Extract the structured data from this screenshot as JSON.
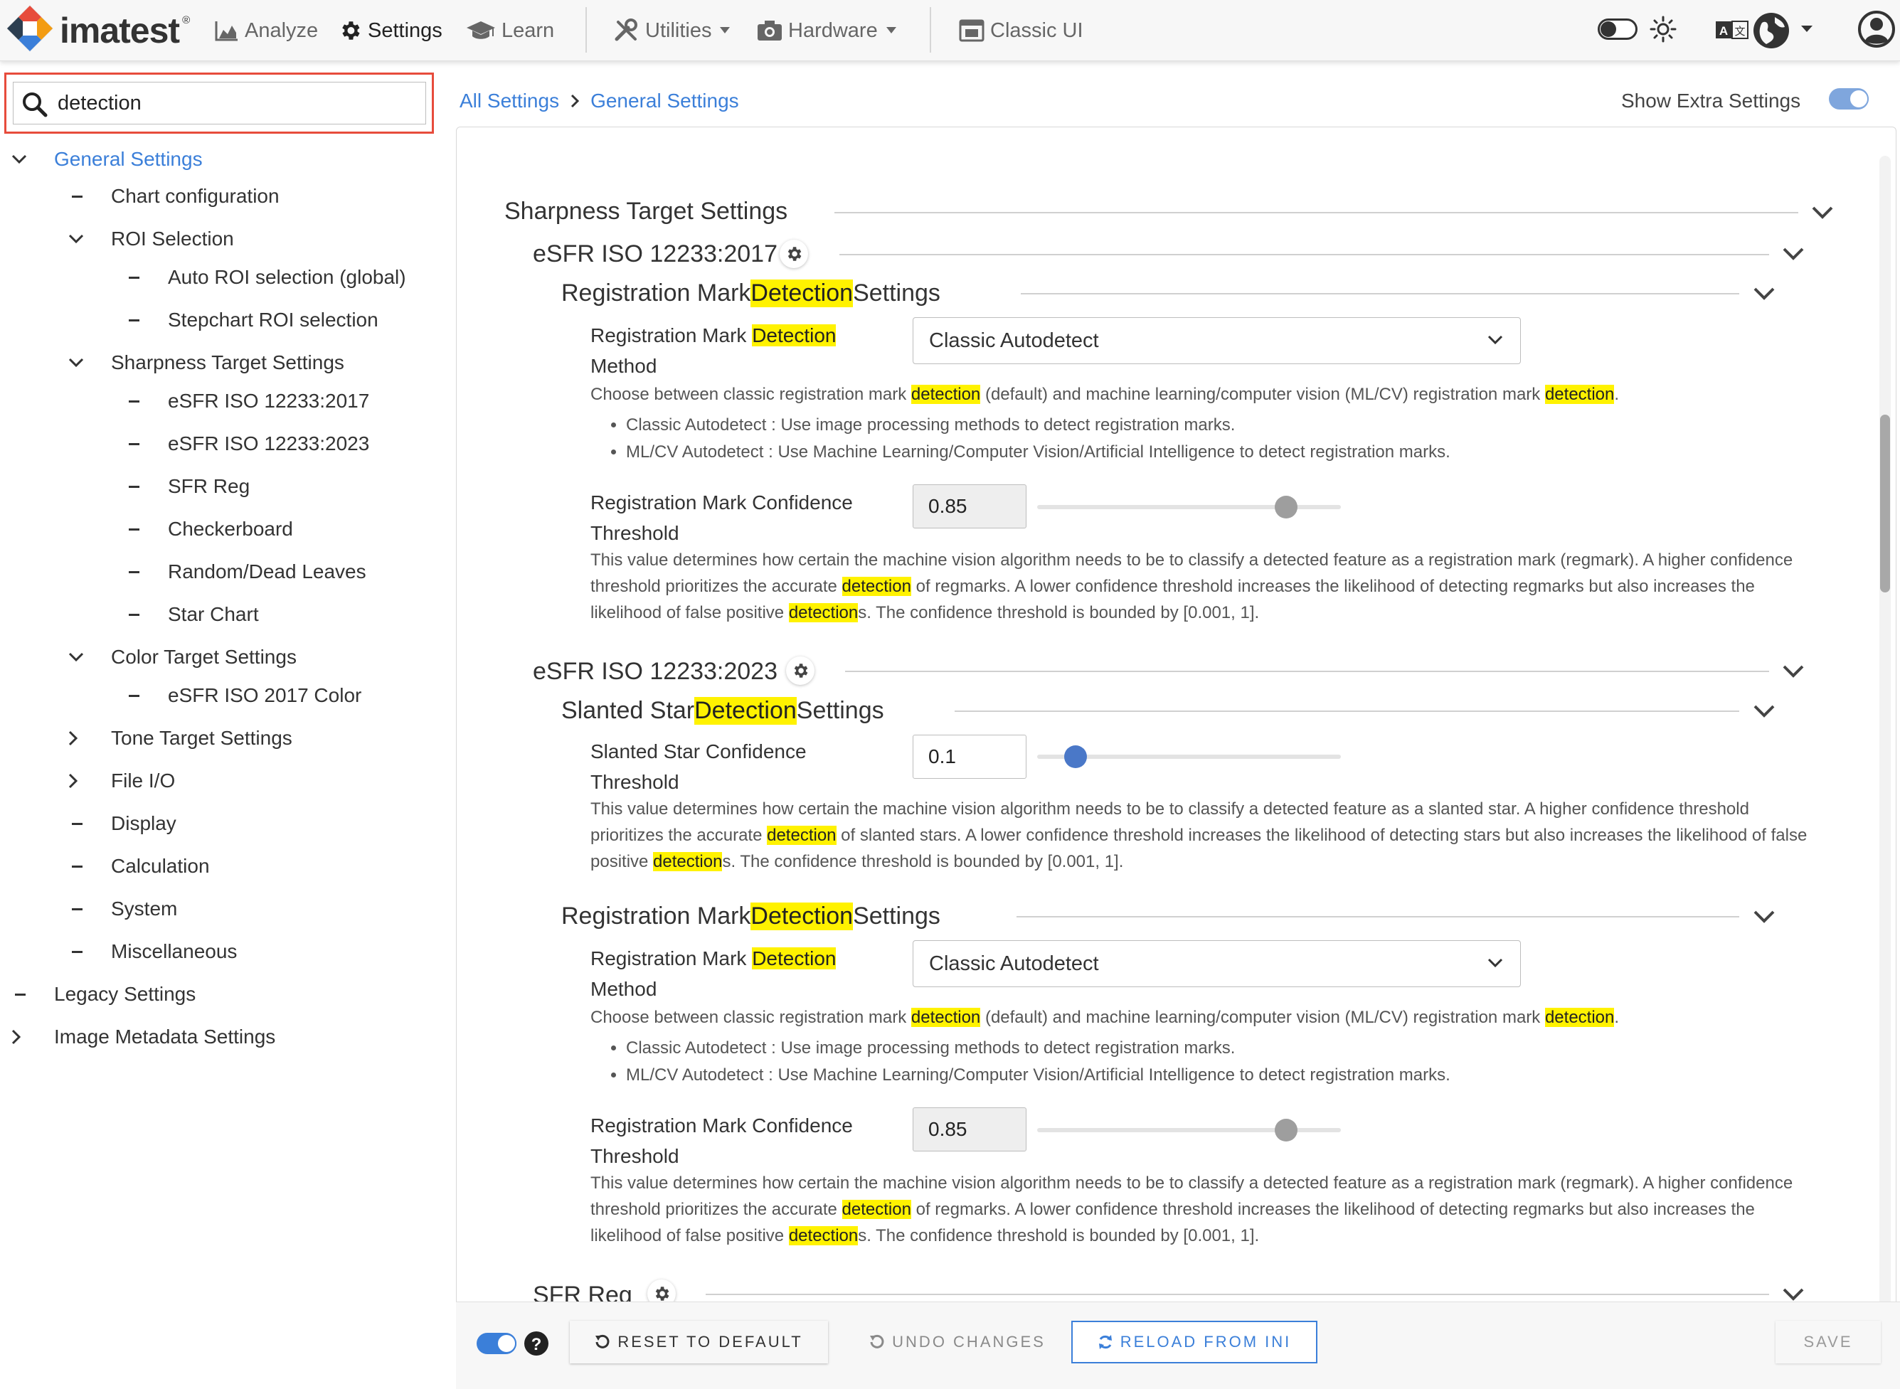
{
  "topbar": {
    "brand": "imatest",
    "brand_mark": "®",
    "nav": [
      {
        "label": "Analyze",
        "icon": "chart-area-icon"
      },
      {
        "label": "Settings",
        "icon": "gear-icon"
      },
      {
        "label": "Learn",
        "icon": "graduation-cap-icon"
      },
      {
        "label": "Utilities",
        "icon": "tools-icon"
      },
      {
        "label": "Hardware",
        "icon": "camera-icon"
      },
      {
        "label": "Classic UI",
        "icon": "window-icon"
      }
    ]
  },
  "search": {
    "value": "detection"
  },
  "tree": [
    {
      "label": "General Settings"
    },
    {
      "label": "Chart configuration"
    },
    {
      "label": "ROI Selection"
    },
    {
      "label": "Auto ROI selection (global)"
    },
    {
      "label": "Stepchart ROI selection"
    },
    {
      "label": "Sharpness Target Settings"
    },
    {
      "label": "eSFR ISO 12233:2017"
    },
    {
      "label": "eSFR ISO 12233:2023"
    },
    {
      "label": "SFR Reg"
    },
    {
      "label": "Checkerboard"
    },
    {
      "label": "Random/Dead Leaves"
    },
    {
      "label": "Star Chart"
    },
    {
      "label": "Color Target Settings"
    },
    {
      "label": "eSFR ISO 2017 Color"
    },
    {
      "label": "Tone Target Settings"
    },
    {
      "label": "File I/O"
    },
    {
      "label": "Display"
    },
    {
      "label": "Calculation"
    },
    {
      "label": "System"
    },
    {
      "label": "Miscellaneous"
    },
    {
      "label": "Legacy Settings"
    },
    {
      "label": "Image Metadata Settings"
    }
  ],
  "breadcrumb": {
    "root": "All Settings",
    "current": "General Settings"
  },
  "show_extra": {
    "label": "Show Extra Settings"
  },
  "content": {
    "sharpness_title": "Sharpness Target Settings",
    "esfr2017": {
      "title": "eSFR ISO 12233:2017",
      "reg_section": {
        "pre": "Registration Mark ",
        "hl": "Detection",
        "post": " Settings"
      },
      "method": {
        "label_pre": "Registration Mark ",
        "label_hl": "Detection",
        "label_post": "Method",
        "value": "Classic Autodetect",
        "desc": {
          "a": "Choose between classic registration mark ",
          "b": "detection",
          "c": " (default) and machine learning/computer vision (ML/CV) registration mark ",
          "d": "detection",
          "e": "."
        },
        "bullets": [
          "Classic Autodetect : Use image processing methods to detect registration marks.",
          "ML/CV Autodetect : Use Machine Learning/Computer Vision/Artificial Intelligence to detect registration marks."
        ]
      },
      "confidence": {
        "label": "Registration Mark Confidence Threshold",
        "value": "0.85",
        "desc": {
          "a": "This value determines how certain the machine vision algorithm needs to be to classify a detected feature as a registration mark (regmark). A higher confidence threshold prioritizes the accurate ",
          "b": "detection",
          "c": " of regmarks. A lower confidence threshold increases the likelihood of detecting regmarks but also increases the likelihood of false positive ",
          "d": "detection",
          "e": "s. The confidence threshold is bounded by [0.001, 1]."
        }
      }
    },
    "esfr2023": {
      "title": "eSFR ISO 12233:2023",
      "star_section": {
        "pre": "Slanted Star ",
        "hl": "Detection",
        "post": " Settings"
      },
      "star_conf": {
        "label": "Slanted Star Confidence Threshold",
        "value": "0.1",
        "desc": {
          "a": "This value determines how certain the machine vision algorithm needs to be to classify a detected feature as a slanted star. A higher confidence threshold prioritizes the accurate ",
          "b": "detection",
          "c": " of slanted stars. A lower confidence threshold increases the likelihood of detecting stars but also increases the likelihood of false positive ",
          "d": "detection",
          "e": "s. The confidence threshold is bounded by [0.001, 1]."
        }
      },
      "reg_section": {
        "pre": "Registration Mark ",
        "hl": "Detection",
        "post": " Settings"
      },
      "method": {
        "label_pre": "Registration Mark ",
        "label_hl": "Detection",
        "label_post": "Method",
        "value": "Classic Autodetect",
        "desc": {
          "a": "Choose between classic registration mark ",
          "b": "detection",
          "c": " (default) and machine learning/computer vision (ML/CV) registration mark ",
          "d": "detection",
          "e": "."
        },
        "bullets": [
          "Classic Autodetect : Use image processing methods to detect registration marks.",
          "ML/CV Autodetect : Use Machine Learning/Computer Vision/Artificial Intelligence to detect registration marks."
        ]
      },
      "confidence": {
        "label": "Registration Mark Confidence Threshold",
        "value": "0.85",
        "desc": {
          "a": "This value determines how certain the machine vision algorithm needs to be to classify a detected feature as a registration mark (regmark). A higher confidence threshold prioritizes the accurate ",
          "b": "detection",
          "c": " of regmarks. A lower confidence threshold increases the likelihood of detecting regmarks but also increases the likelihood of false positive ",
          "d": "detection",
          "e": "s. The confidence threshold is bounded by [0.001, 1]."
        }
      }
    },
    "sfrreg_title": "SFR Reg"
  },
  "footer": {
    "reset": "RESET TO DEFAULT",
    "undo": "UNDO CHANGES",
    "reload": "RELOAD FROM INI",
    "save": "SAVE"
  },
  "colors": {
    "accent": "#3b7fd9",
    "highlight": "#fff200",
    "search_border": "#e74c3c"
  }
}
